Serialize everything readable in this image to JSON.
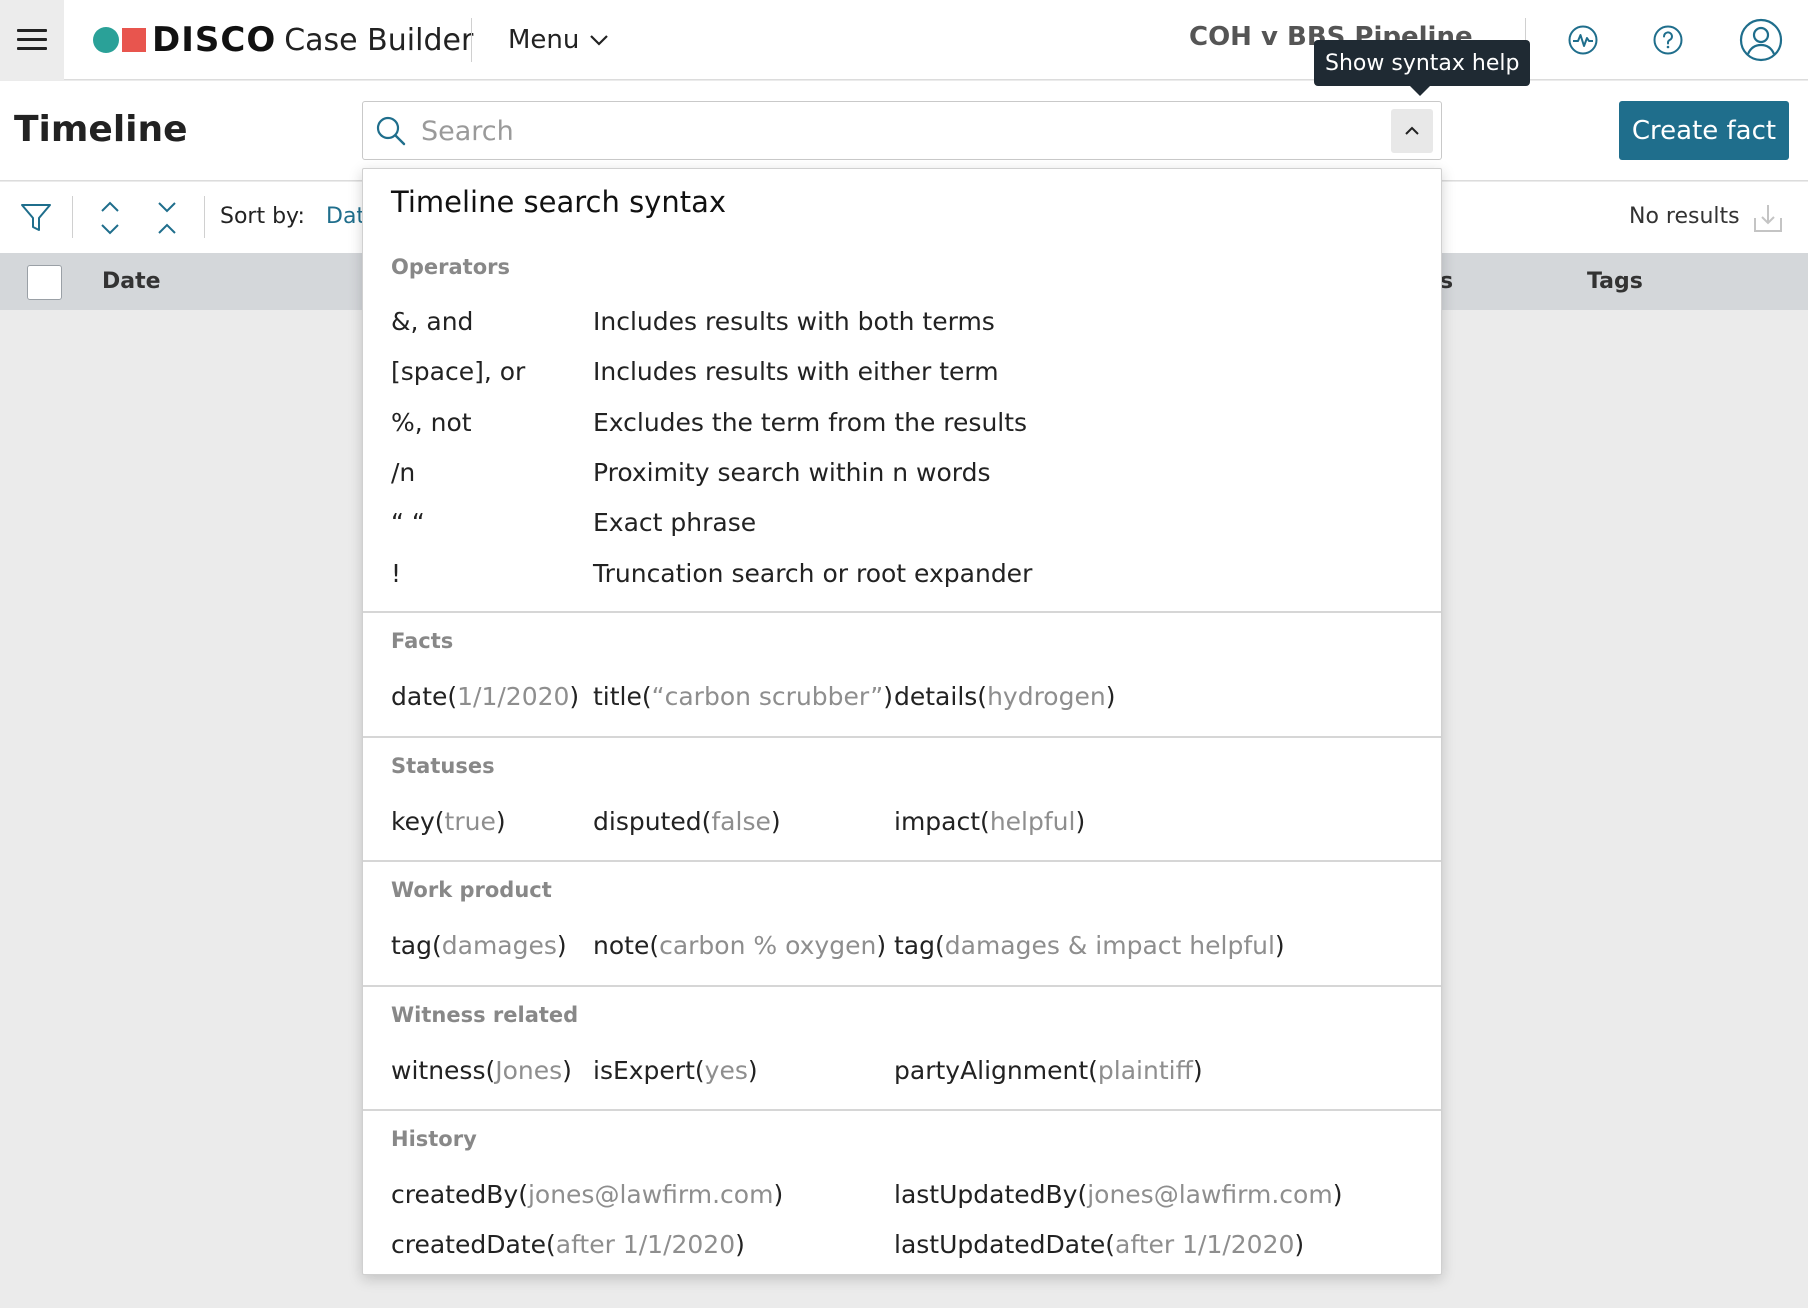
{
  "header": {
    "brand": "DISCO",
    "app_name": "Case Builder",
    "menu_label": "Menu",
    "case_name": "COH v BBS Pipeline Sol...",
    "icons": [
      "hamburger-icon",
      "activity-icon",
      "help-icon",
      "user-icon"
    ]
  },
  "tooltip": {
    "text": "Show syntax help"
  },
  "page": {
    "title": "Timeline",
    "search_placeholder": "Search",
    "create_button": "Create fact"
  },
  "toolbar": {
    "sort_label": "Sort by:",
    "sort_value": "Dat",
    "no_results": "No results"
  },
  "table": {
    "columns": [
      "Date",
      "s",
      "Tags"
    ]
  },
  "syntax_panel": {
    "title": "Timeline search syntax",
    "operators_heading": "Operators",
    "operators": [
      {
        "op": "&, and",
        "desc": "Includes results with both terms"
      },
      {
        "op": "[space], or",
        "desc": "Includes results with either term"
      },
      {
        "op": "%, not",
        "desc": "Excludes the term from the results"
      },
      {
        "op": "/n",
        "desc": "Proximity search within n words"
      },
      {
        "op": "“ “",
        "desc": "Exact phrase"
      },
      {
        "op": "!",
        "desc": "Truncation search or root expander"
      }
    ],
    "facts": {
      "heading": "Facts",
      "examples": [
        {
          "fn": "date",
          "arg": "1/1/2020"
        },
        {
          "fn": "title",
          "arg": "“carbon scrubber”"
        },
        {
          "fn": "details",
          "arg": "hydrogen"
        }
      ]
    },
    "statuses": {
      "heading": "Statuses",
      "examples": [
        {
          "fn": "key",
          "arg": "true"
        },
        {
          "fn": "disputed",
          "arg": "false"
        },
        {
          "fn": "impact",
          "arg": "helpful"
        }
      ]
    },
    "work_product": {
      "heading": "Work product",
      "examples": [
        {
          "fn": "tag",
          "arg": "damages"
        },
        {
          "fn": "note",
          "arg": "carbon % oxygen"
        },
        {
          "fn": "tag",
          "arg": "damages & impact helpful"
        }
      ]
    },
    "witness": {
      "heading": "Witness related",
      "examples": [
        {
          "fn": "witness",
          "arg": "Jones"
        },
        {
          "fn": "isExpert",
          "arg": "yes"
        },
        {
          "fn": "partyAlignment",
          "arg": "plaintiff"
        }
      ]
    },
    "history": {
      "heading": "History",
      "examples": [
        {
          "fn": "createdBy",
          "arg": "jones@lawfirm.com"
        },
        {
          "fn": "lastUpdatedBy",
          "arg": "jones@lawfirm.com"
        },
        {
          "fn": "createdDate",
          "arg": "after 1/1/2020"
        },
        {
          "fn": "lastUpdatedDate",
          "arg": "after 1/1/2020"
        }
      ]
    }
  },
  "colors": {
    "accent": "#1f6e8c",
    "logo_dot": "#2aa198",
    "logo_square": "#e8554e",
    "tooltip_bg": "#1f2a33"
  }
}
